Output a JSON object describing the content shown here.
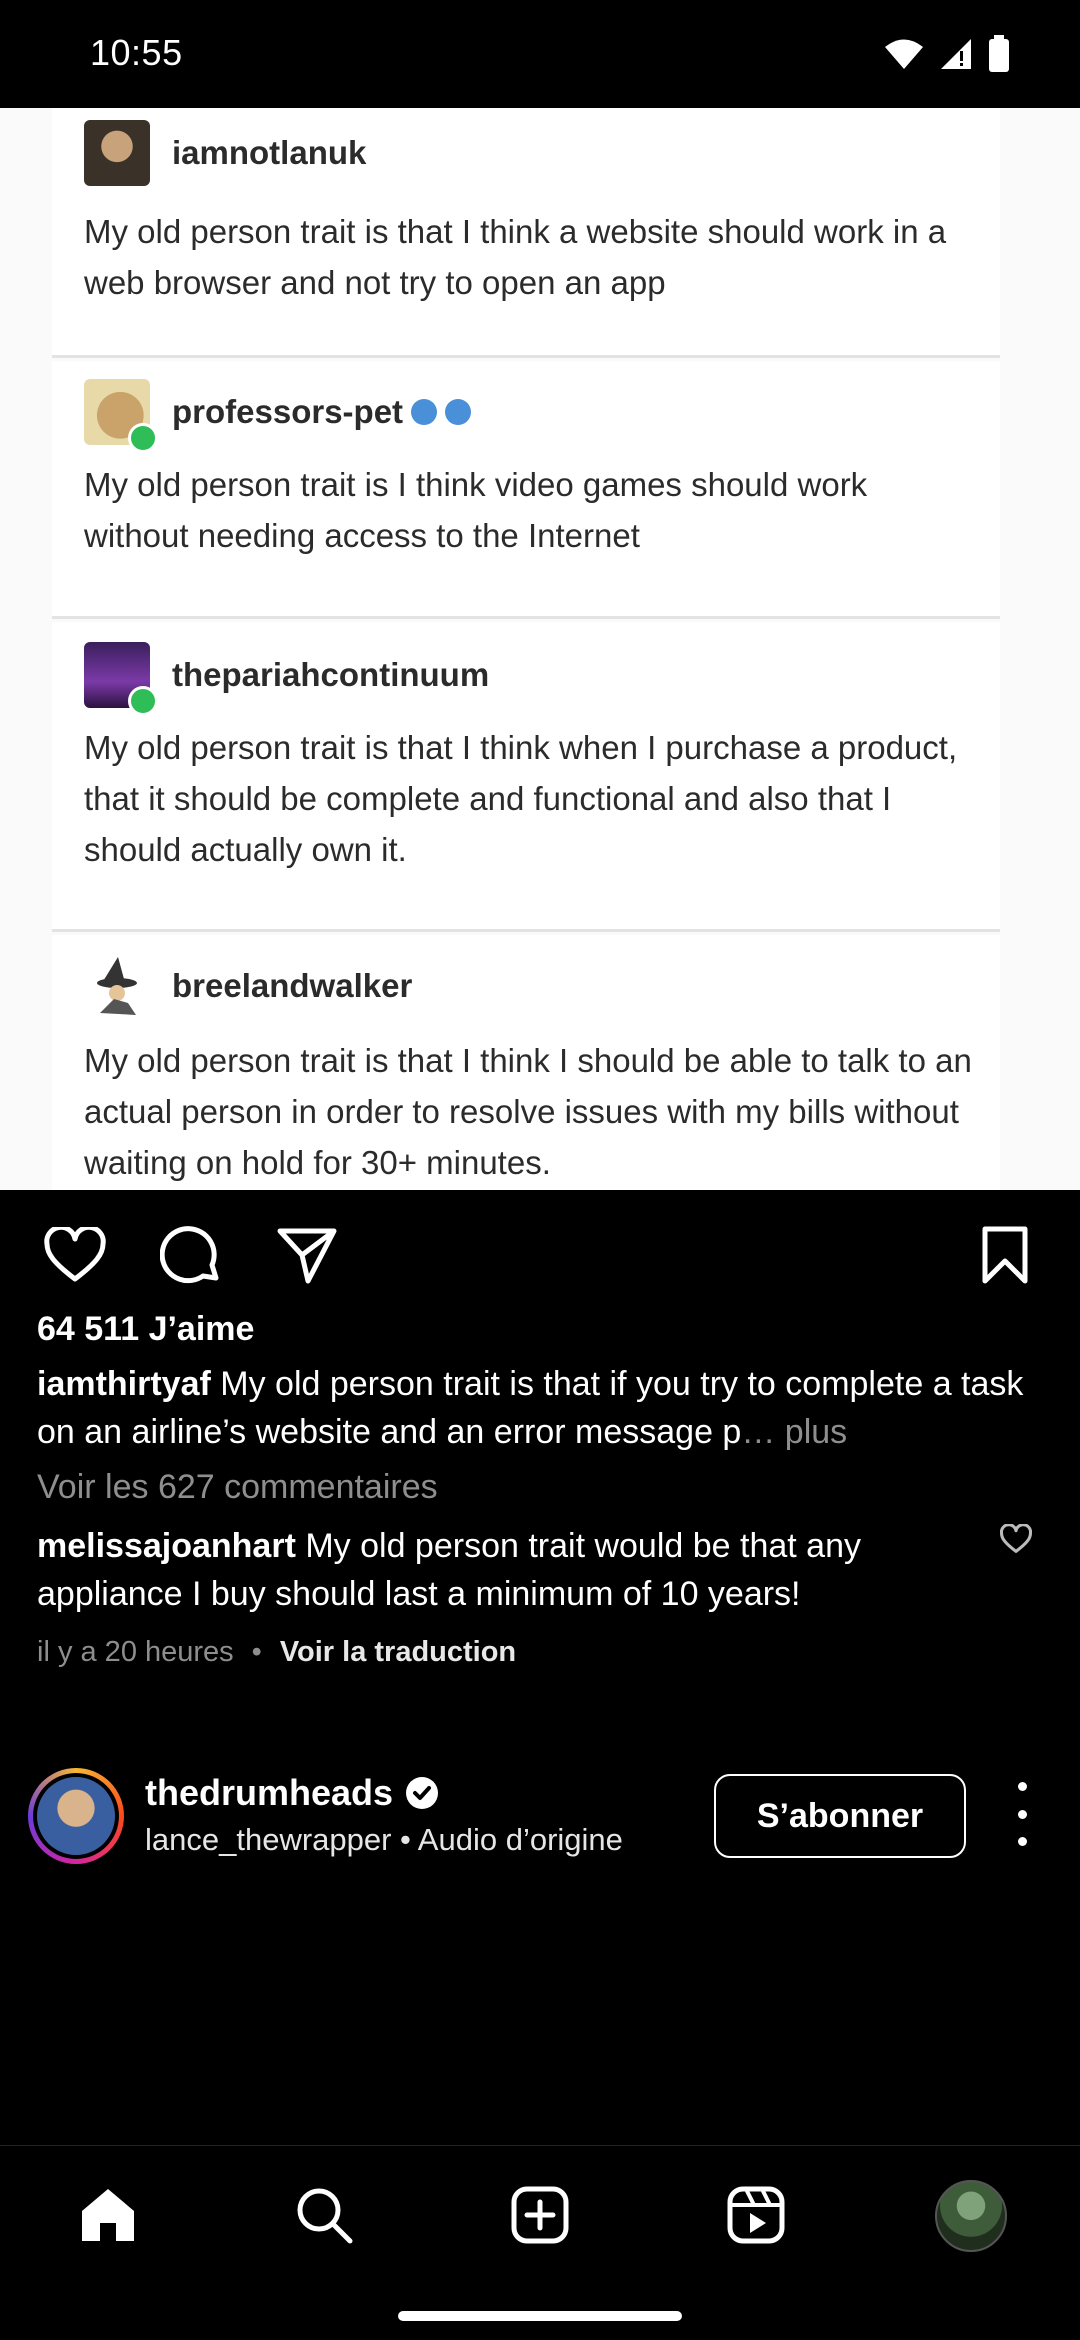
{
  "status_bar": {
    "time": "10:55"
  },
  "post_image": {
    "entries": [
      {
        "username": "iamnotlanuk",
        "text": "My old person trait is that I think a website should work in a web browser and not try to open an app",
        "verified": false
      },
      {
        "username": "professors-pet",
        "text": "My old person trait is I think video games should work without needing access to the Internet",
        "verified": true
      },
      {
        "username": "thepariahcontinuum",
        "text": "My old person trait is that I think when I purchase a product, that it should be complete and functional and also that I should actually own it.",
        "verified": false
      },
      {
        "username": "breelandwalker",
        "text": "My old person trait is that I think I should be able to talk to an actual person in order to resolve issues with my bills without waiting on hold for 30+ minutes.",
        "verified": false
      }
    ]
  },
  "post": {
    "likes": "64 511 J’aime",
    "author": "iamthirtyaf",
    "caption": "My old person trait is that if you try to complete a task on an airline’s website and an error message p",
    "more_label": "… plus",
    "view_comments": "Voir les 627 commentaires",
    "comment": {
      "author": "melissajoanhart",
      "text": "My old person trait would be that any appliance I buy should last a minimum of 10 years!"
    },
    "timestamp": "il y a 20 heures",
    "separator": "•",
    "translate": "Voir la traduction"
  },
  "next_post": {
    "username": "thedrumheads",
    "subtitle": "lance_thewrapper • Audio d’origine",
    "follow_label": "S’abonner"
  },
  "icons": {
    "like": "heart-icon",
    "comment": "comment-icon",
    "share": "send-icon",
    "save": "bookmark-icon",
    "more": "more-vertical-icon"
  },
  "bottom_nav": [
    "home",
    "search",
    "create",
    "reels",
    "profile"
  ]
}
